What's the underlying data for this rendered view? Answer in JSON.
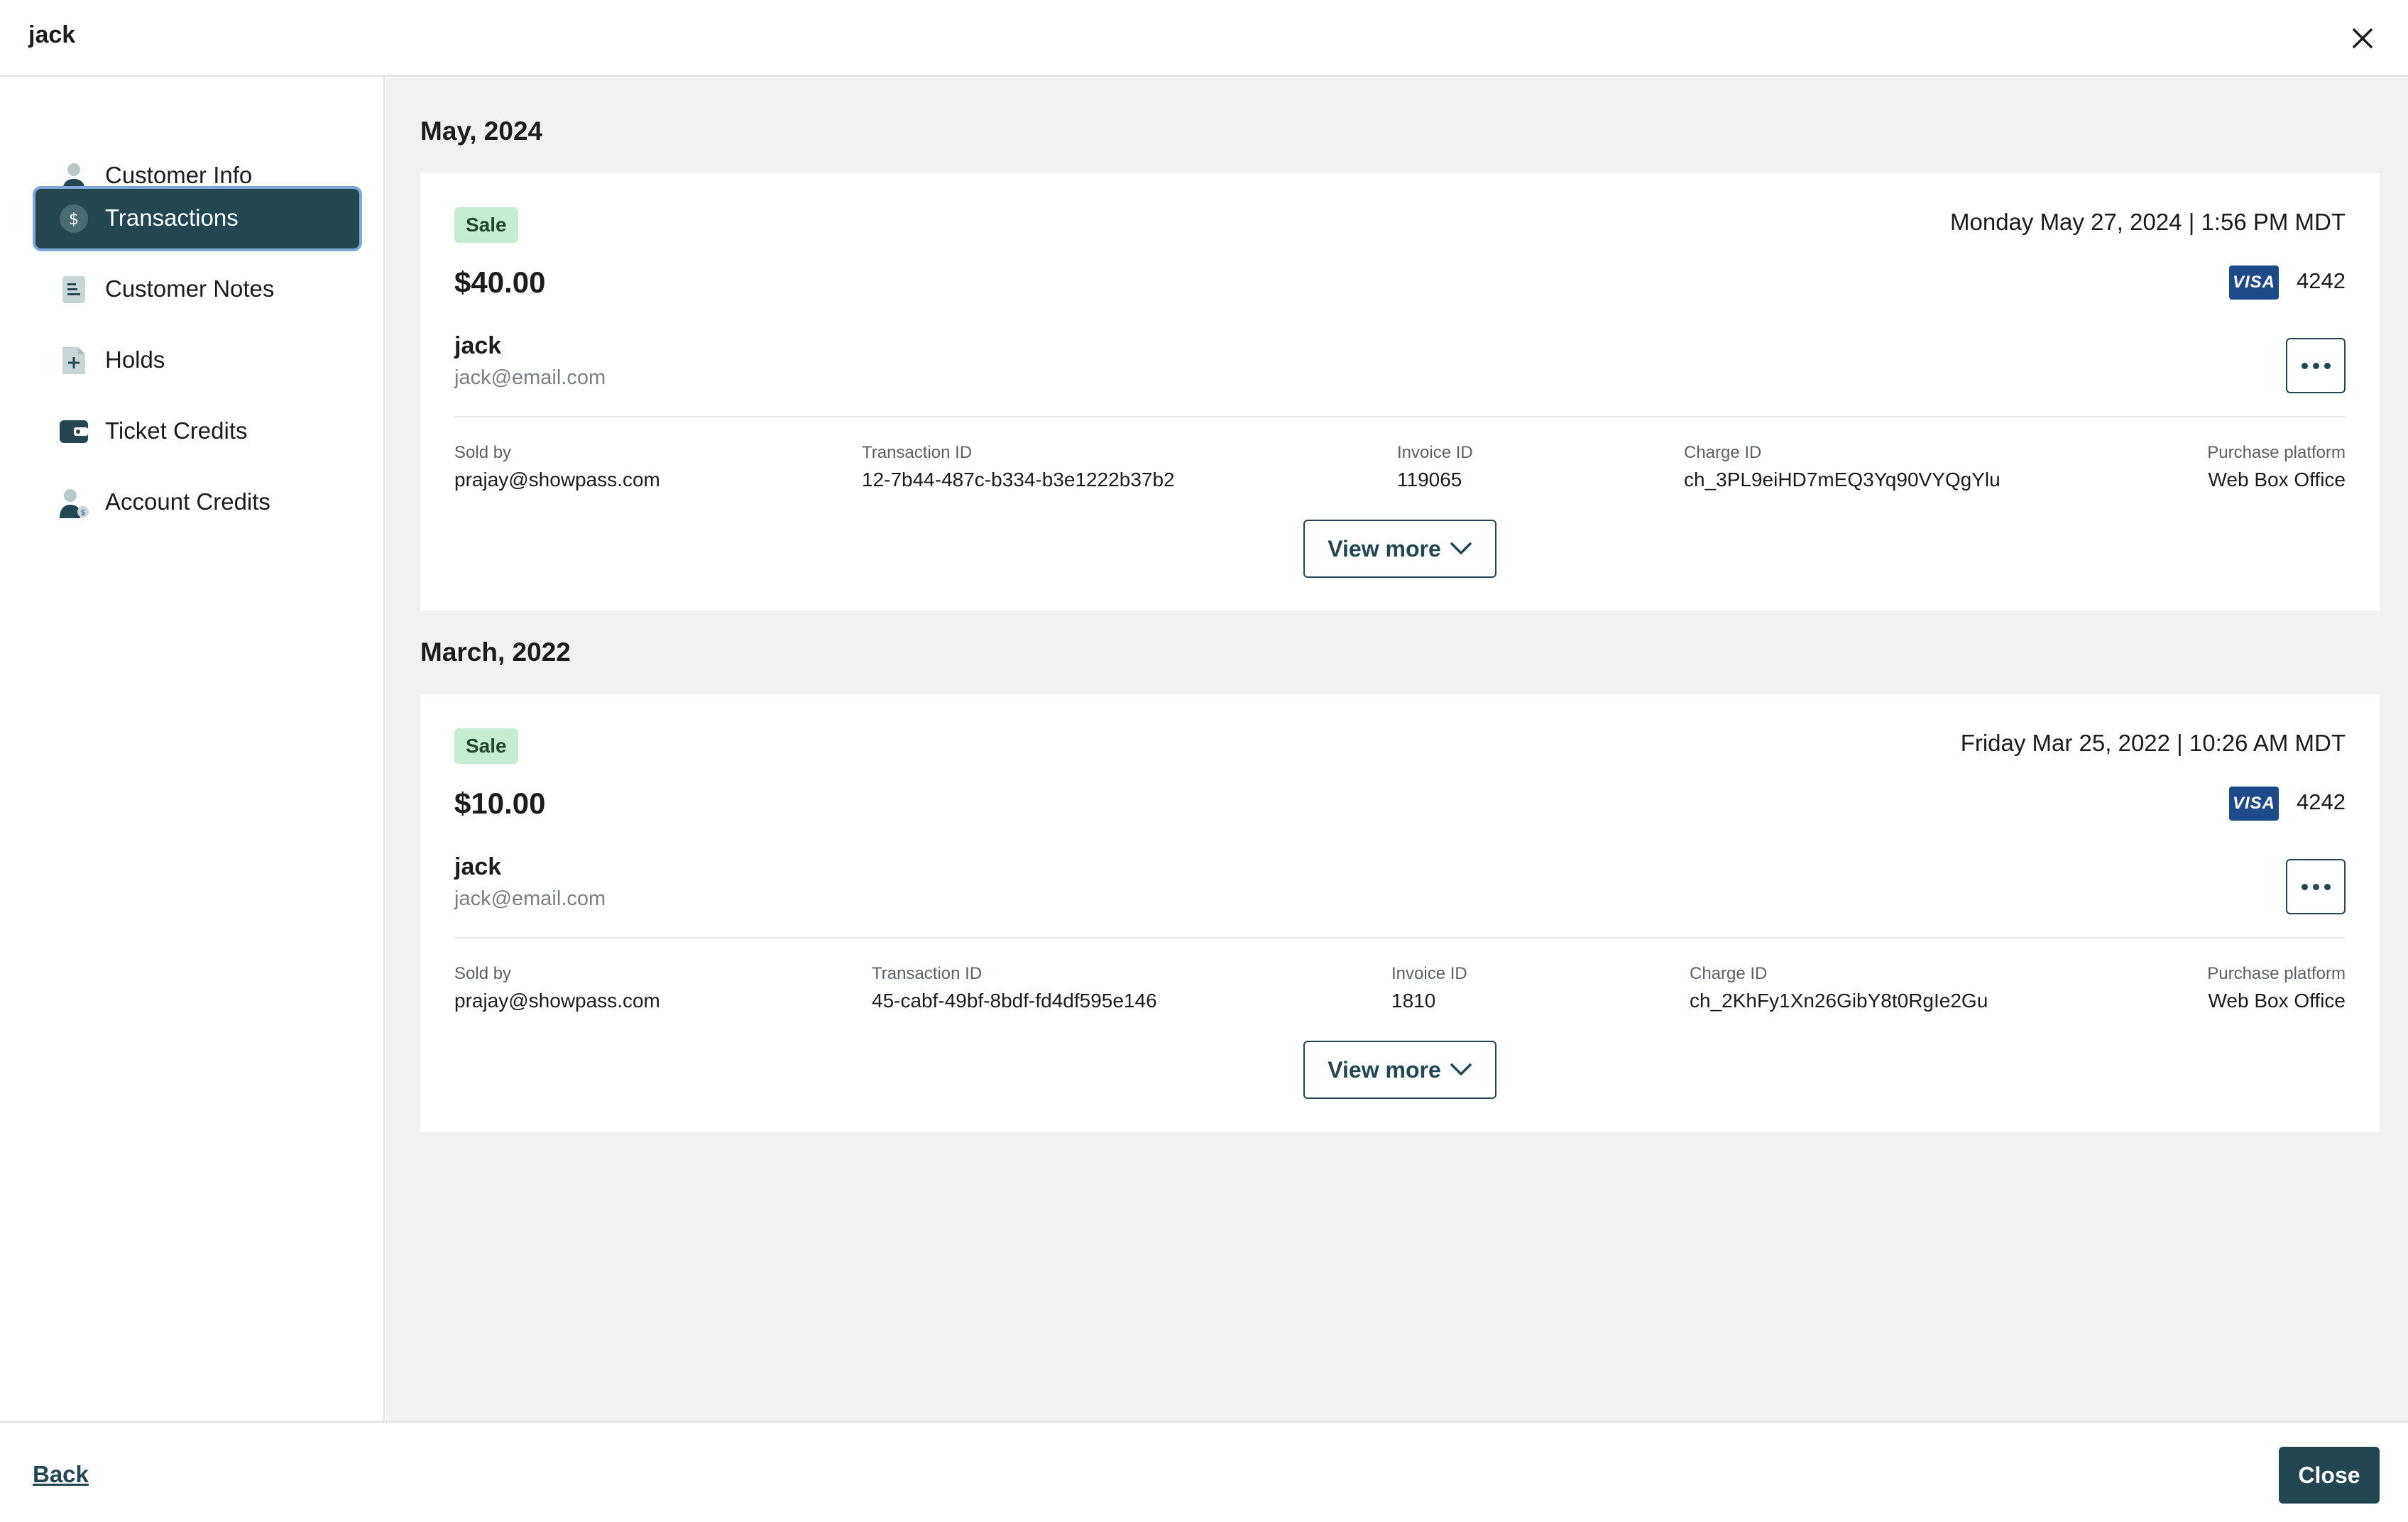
{
  "header": {
    "title": "jack"
  },
  "sidebar": {
    "items": [
      {
        "label": "Customer Info",
        "icon": "person-icon",
        "active": false
      },
      {
        "label": "Transactions",
        "icon": "dollar-icon",
        "active": true
      },
      {
        "label": "Customer Notes",
        "icon": "notes-icon",
        "active": false
      },
      {
        "label": "Holds",
        "icon": "hold-document-icon",
        "active": false
      },
      {
        "label": "Ticket Credits",
        "icon": "wallet-icon",
        "active": false
      },
      {
        "label": "Account Credits",
        "icon": "person-credit-icon",
        "active": false
      }
    ]
  },
  "transactions": [
    {
      "month": "May, 2024",
      "type": "Sale",
      "datetime": "Monday May 27, 2024 | 1:56 PM MDT",
      "amount": "$40.00",
      "card_brand": "VISA",
      "card_last4": "4242",
      "customer_name": "jack",
      "customer_email": "jack@email.com",
      "fields": {
        "sold_by": {
          "label": "Sold by",
          "value": "prajay@showpass.com"
        },
        "transaction_id": {
          "label": "Transaction ID",
          "value": "12-7b44-487c-b334-b3e1222b37b2"
        },
        "invoice_id": {
          "label": "Invoice ID",
          "value": "119065"
        },
        "charge_id": {
          "label": "Charge ID",
          "value": "ch_3PL9eiHD7mEQ3Yq90VYQgYlu"
        },
        "purchase_platform": {
          "label": "Purchase platform",
          "value": "Web Box Office"
        }
      },
      "view_more_label": "View more"
    },
    {
      "month": "March, 2022",
      "type": "Sale",
      "datetime": "Friday Mar 25, 2022 | 10:26 AM MDT",
      "amount": "$10.00",
      "card_brand": "VISA",
      "card_last4": "4242",
      "customer_name": "jack",
      "customer_email": "jack@email.com",
      "fields": {
        "sold_by": {
          "label": "Sold by",
          "value": "prajay@showpass.com"
        },
        "transaction_id": {
          "label": "Transaction ID",
          "value": "45-cabf-49bf-8bdf-fd4df595e146"
        },
        "invoice_id": {
          "label": "Invoice ID",
          "value": "1810"
        },
        "charge_id": {
          "label": "Charge ID",
          "value": "ch_2KhFy1Xn26GibY8t0RgIe2Gu"
        },
        "purchase_platform": {
          "label": "Purchase platform",
          "value": "Web Box Office"
        }
      },
      "view_more_label": "View more"
    }
  ],
  "footer": {
    "back_label": "Back",
    "close_label": "Close"
  },
  "colors": {
    "primary": "#234650",
    "sale_badge_bg": "#c7ecd1",
    "visa_blue": "#1f4a8a",
    "content_bg": "#f0f1f3"
  }
}
